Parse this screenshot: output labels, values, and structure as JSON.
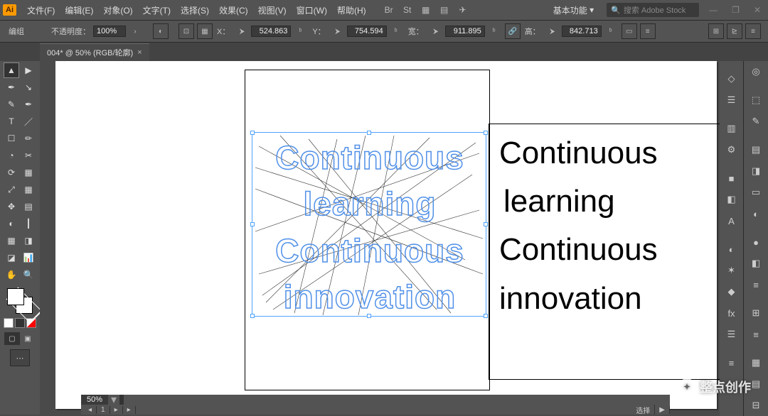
{
  "app": {
    "icon_label": "Ai"
  },
  "menu": [
    "文件(F)",
    "编辑(E)",
    "对象(O)",
    "文字(T)",
    "选择(S)",
    "效果(C)",
    "视图(V)",
    "窗口(W)",
    "帮助(H)"
  ],
  "top_icons": [
    "Br",
    "St",
    "▦",
    "▤",
    "✈"
  ],
  "workspace": {
    "label": "基本功能",
    "chev": "▾"
  },
  "search": {
    "placeholder": "搜索 Adobe Stock",
    "icon": "🔍"
  },
  "win_controls": [
    "—",
    "❐",
    "✕"
  ],
  "control_bar": {
    "mode": "编组",
    "opacity_label": "不透明度：",
    "opacity_value": "100%",
    "x_label": "X：",
    "x_value": "524.863",
    "y_label": "Y：",
    "y_value": "754.594",
    "w_label": "宽：",
    "w_value": "911.895",
    "h_label": "高：",
    "h_value": "842.713"
  },
  "tab": {
    "title": "004* @ 50% (RGB/轮廓)",
    "close": "×"
  },
  "tools_left": [
    "▲",
    "▶",
    "✒",
    "↘",
    "✎",
    "✒",
    "T",
    "／",
    "☐",
    "✏",
    "◔",
    "✂",
    "⟳",
    "▦",
    "⤢",
    "▦",
    "✥",
    "▤",
    "◐",
    "┃",
    "▦",
    "◨",
    "◪",
    "📊",
    "✋",
    "🔍"
  ],
  "canvas": {
    "outline_lines": [
      "Continuous",
      "learning",
      "Continuous",
      "innovation"
    ],
    "live_lines": [
      "Continuous",
      "learning",
      "Continuous",
      "innovation"
    ]
  },
  "zoom": "50%",
  "status": {
    "tool": "选择",
    "arrow": "▶"
  },
  "right_panels_a": [
    "◇",
    "☰",
    "▥",
    "⚙",
    "■",
    "◧",
    "A",
    "◐",
    "✶",
    "◆",
    "fx",
    "☰",
    "≡"
  ],
  "right_panels_b": [
    "◎",
    "⬚",
    "✎",
    "▤",
    "◨",
    "▭",
    "◐",
    "●",
    "◧",
    "≡",
    "⊞",
    "≡",
    "▦",
    "▤",
    "⊟"
  ],
  "watermark": {
    "text": "整点创作"
  }
}
